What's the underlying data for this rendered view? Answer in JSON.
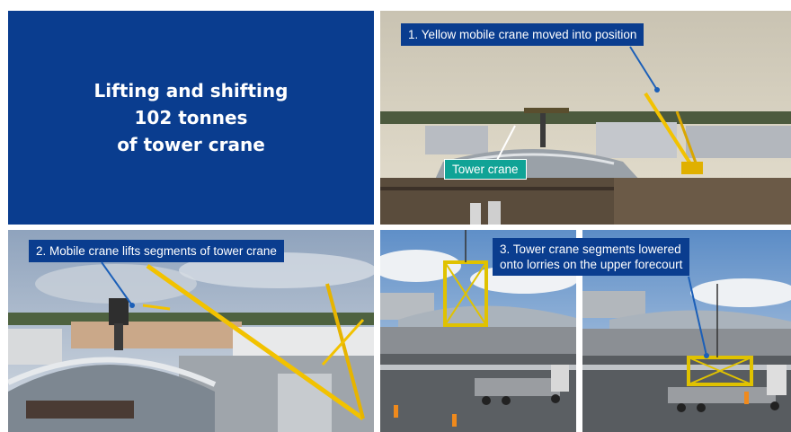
{
  "title": {
    "line1": "Lifting and shifting",
    "line2": "102 tonnes",
    "line3": "of tower crane"
  },
  "photo1": {
    "caption": "1. Yellow mobile crane moved into position",
    "tag": "Tower crane"
  },
  "photo2": {
    "caption": "2. Mobile crane lifts segments of tower crane"
  },
  "photo3": {
    "caption_line1": "3. Tower crane segments lowered",
    "caption_line2": "onto lorries on the upper forecourt"
  },
  "colors": {
    "panel_blue": "#0a3d8f",
    "tag_teal": "#10a396",
    "crane_yellow": "#f2c200"
  }
}
